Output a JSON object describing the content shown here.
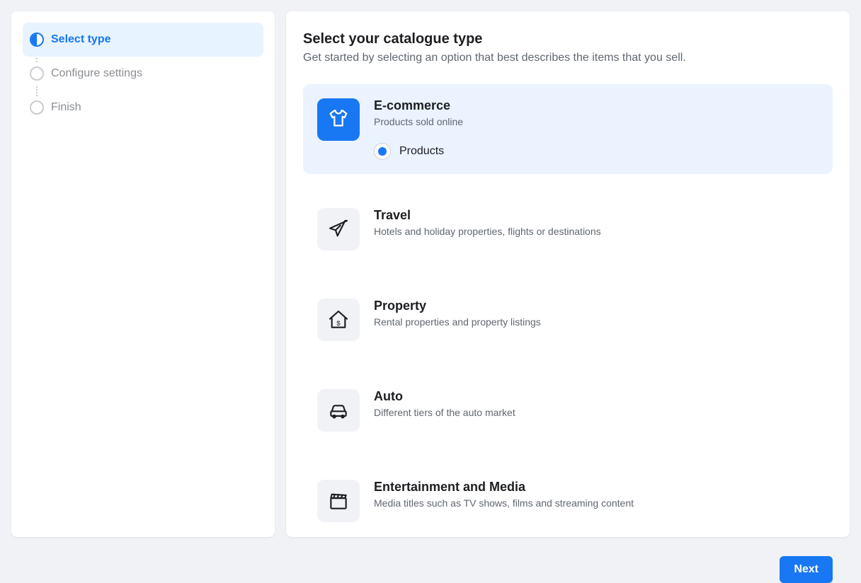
{
  "sidebar": {
    "steps": [
      {
        "label": "Select type",
        "active": true
      },
      {
        "label": "Configure settings",
        "active": false
      },
      {
        "label": "Finish",
        "active": false
      }
    ]
  },
  "main": {
    "title": "Select your catalogue type",
    "subtitle": "Get started by selecting an option that best describes the items that you sell.",
    "options": [
      {
        "id": "ecommerce",
        "title": "E-commerce",
        "desc": "Products sold online",
        "selected": true,
        "radio_label": "Products",
        "radio_selected": true
      },
      {
        "id": "travel",
        "title": "Travel",
        "desc": "Hotels and holiday properties, flights or destinations",
        "selected": false
      },
      {
        "id": "property",
        "title": "Property",
        "desc": "Rental properties and property listings",
        "selected": false
      },
      {
        "id": "auto",
        "title": "Auto",
        "desc": "Different tiers of the auto market",
        "selected": false
      },
      {
        "id": "entertainment",
        "title": "Entertainment and Media",
        "desc": "Media titles such as TV shows, films and streaming content",
        "selected": false
      }
    ],
    "next_label": "Next"
  }
}
